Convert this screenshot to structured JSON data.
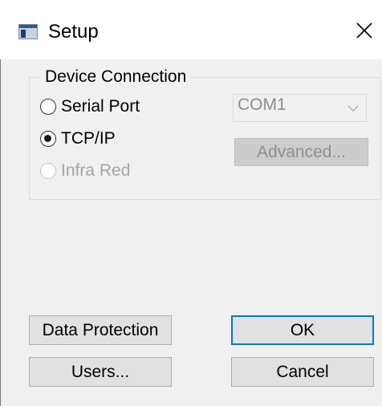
{
  "window": {
    "title": "Setup",
    "app_icon": "setup-window-icon",
    "close_icon": "close-icon"
  },
  "device_connection": {
    "legend": "Device Connection",
    "options": [
      {
        "label": "Serial Port",
        "selected": false,
        "enabled": true
      },
      {
        "label": "TCP/IP",
        "selected": true,
        "enabled": true
      },
      {
        "label": "Infra Red",
        "selected": false,
        "enabled": false
      }
    ],
    "port": {
      "value": "COM1",
      "enabled": false,
      "icon": "chevron-down-icon"
    },
    "advanced_label": "Advanced..."
  },
  "buttons": {
    "data_protection": "Data Protection",
    "users": "Users...",
    "ok": "OK",
    "cancel": "Cancel"
  },
  "colors": {
    "dialog_bg": "#f0f0f0",
    "button_bg": "#e1e1e1",
    "default_button_border": "#0078d7",
    "disabled_text": "#a6a6a6"
  }
}
